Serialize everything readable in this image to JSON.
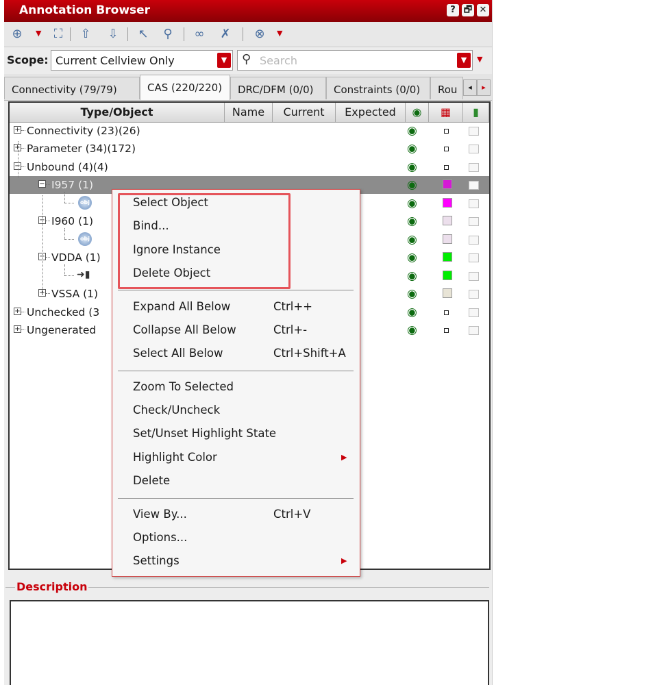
{
  "window": {
    "title": "Annotation Browser",
    "help_glyph": "?",
    "restore_glyph": "🗗",
    "close_glyph": "✕"
  },
  "toolbar": {
    "items": [
      {
        "name": "select-mode-icon",
        "glyph": "⊕"
      },
      {
        "name": "zoom-fit-icon",
        "glyph": "⛶"
      },
      {
        "name": "up-arrow-icon",
        "glyph": "⇧"
      },
      {
        "name": "down-arrow-icon",
        "glyph": "⇩"
      },
      {
        "name": "pointer-icon",
        "glyph": "↖"
      },
      {
        "name": "magnifier-icon",
        "glyph": "⚲"
      },
      {
        "name": "link-icon",
        "glyph": "∞"
      },
      {
        "name": "unlink-icon",
        "glyph": "✗"
      },
      {
        "name": "stop-icon",
        "glyph": "⊗"
      }
    ]
  },
  "scope": {
    "label": "Scope:",
    "value": "Current Cellview Only"
  },
  "search": {
    "placeholder": "Search"
  },
  "tabs": [
    "Connectivity (79/79)",
    "CAS (220/220)",
    "DRC/DFM (0/0)",
    "Constraints (0/0)",
    "Rou"
  ],
  "columns": [
    "Type/Object",
    "Name",
    "Current",
    "Expected"
  ],
  "tree": [
    {
      "label": "Connectivity (23)(26)",
      "indent": 0,
      "exp": "+",
      "eye": true,
      "mark": "small",
      "color": ""
    },
    {
      "label": "Parameter (34)(172)",
      "indent": 0,
      "exp": "+",
      "eye": true,
      "mark": "small",
      "color": ""
    },
    {
      "label": "Unbound (4)(4)",
      "indent": 0,
      "exp": "−",
      "eye": true,
      "mark": "small",
      "color": ""
    },
    {
      "label": "I957 (1)",
      "indent": 1,
      "exp": "−",
      "eye": true,
      "mark": "sq",
      "color": "#d41ad4",
      "selected": true
    },
    {
      "label": "",
      "indent": 2,
      "exp": "",
      "eye": true,
      "mark": "sq",
      "color": "#ff00ff",
      "icon": "obj"
    },
    {
      "label": "I960 (1)",
      "indent": 1,
      "exp": "−",
      "eye": true,
      "mark": "sq",
      "color": "#ecdfec"
    },
    {
      "label": "",
      "indent": 2,
      "exp": "",
      "eye": true,
      "mark": "sq",
      "color": "#ecdfec",
      "icon": "obj"
    },
    {
      "label": "VDDA (1)",
      "indent": 1,
      "exp": "−",
      "eye": true,
      "mark": "sq",
      "color": "#00ee00"
    },
    {
      "label": "",
      "indent": 2,
      "exp": "",
      "eye": true,
      "mark": "sq",
      "color": "#00ee00",
      "icon": "pin"
    },
    {
      "label": "VSSA (1)",
      "indent": 1,
      "exp": "+",
      "eye": true,
      "mark": "sq",
      "color": "#e8e4d6"
    },
    {
      "label": "Unchecked (3",
      "indent": 0,
      "exp": "+",
      "eye": true,
      "mark": "small",
      "color": ""
    },
    {
      "label": "Ungenerated",
      "indent": 0,
      "exp": "+",
      "eye": true,
      "mark": "small",
      "color": ""
    }
  ],
  "description": {
    "label": "Description"
  },
  "context_menu": {
    "groups": [
      [
        {
          "label": "Select Object"
        },
        {
          "label": "Bind..."
        },
        {
          "label": "Ignore Instance"
        },
        {
          "label": "Delete Object"
        }
      ],
      [
        {
          "label": "Expand All Below",
          "shortcut": "Ctrl++"
        },
        {
          "label": "Collapse All Below",
          "shortcut": "Ctrl+-"
        },
        {
          "label": "Select All Below",
          "shortcut": "Ctrl+Shift+A"
        }
      ],
      [
        {
          "label": "Zoom To Selected"
        },
        {
          "label": "Check/Uncheck"
        },
        {
          "label": "Set/Unset Highlight State"
        },
        {
          "label": "Highlight Color",
          "submenu": true
        },
        {
          "label": "Delete"
        }
      ],
      [
        {
          "label": "View By...",
          "shortcut": "Ctrl+V"
        },
        {
          "label": "Options..."
        },
        {
          "label": "Settings",
          "submenu": true
        }
      ]
    ]
  },
  "colors": {
    "accent": "#c8000a",
    "highlight_box": "#e5545a",
    "selected_row": "#8c8c8c",
    "eye": "#0d6b10"
  }
}
